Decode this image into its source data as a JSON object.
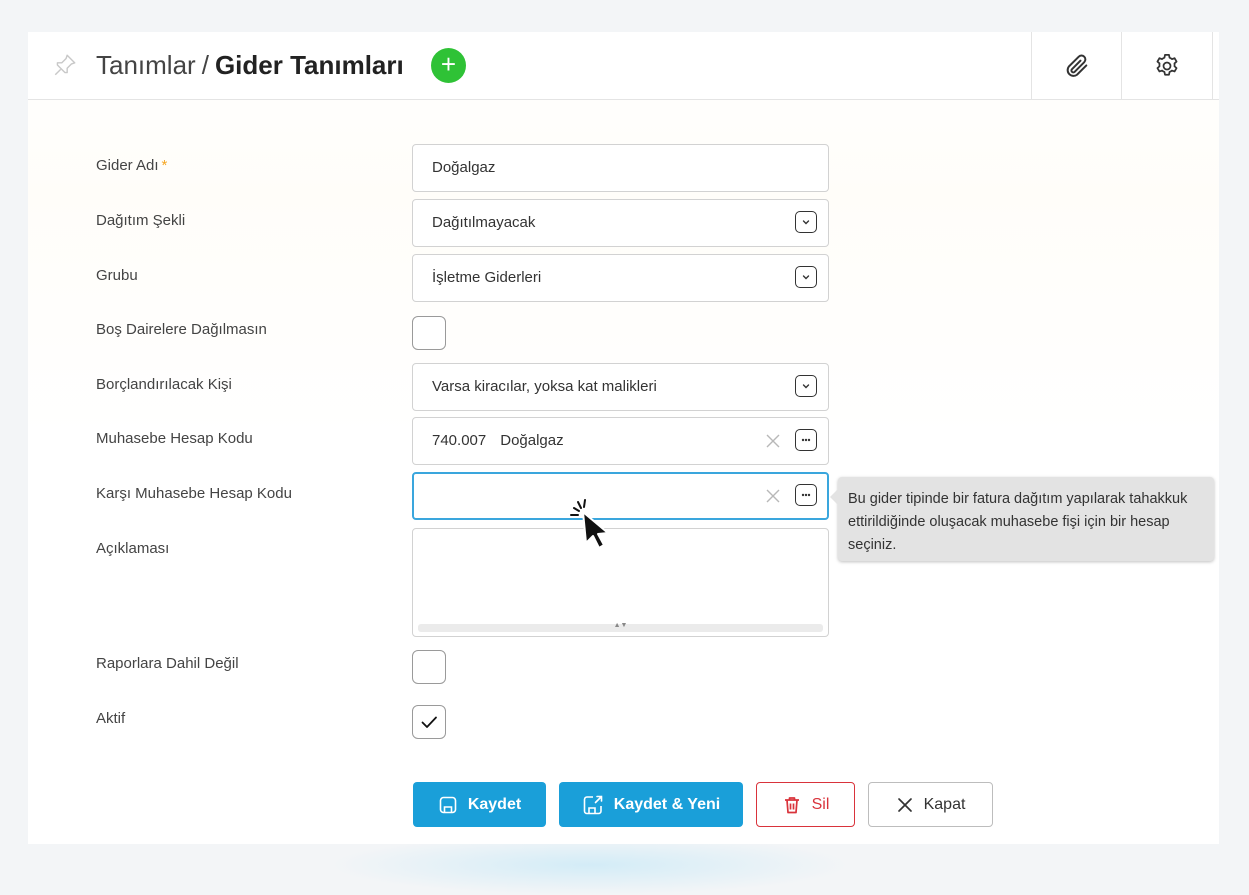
{
  "header": {
    "breadcrumb_parent": "Tanımlar",
    "breadcrumb_separator": "/",
    "breadcrumb_current": "Gider Tanımları",
    "add_label": "+",
    "icons": {
      "pin": "pin-icon",
      "add": "plus-icon",
      "attach": "paperclip-icon",
      "settings": "gear-icon"
    }
  },
  "form": {
    "gider_adi": {
      "label": "Gider Adı",
      "required_mark": "*",
      "value": "Doğalgaz"
    },
    "dagitim_sekli": {
      "label": "Dağıtım Şekli",
      "value": "Dağıtılmayacak"
    },
    "grubu": {
      "label": "Grubu",
      "value": "İşletme Giderleri"
    },
    "bos_daireler": {
      "label": "Boş Dairelere Dağılmasın",
      "checked": false
    },
    "borclandirilacak": {
      "label": "Borçlandırılacak Kişi",
      "value": "Varsa kiracılar, yoksa kat malikleri"
    },
    "muhasebe_kodu": {
      "label": "Muhasebe Hesap Kodu",
      "code": "740.007",
      "name": "Doğalgaz"
    },
    "karsi_muhasebe_kodu": {
      "label": "Karşı Muhasebe Hesap Kodu",
      "value": ""
    },
    "aciklama": {
      "label": "Açıklaması",
      "value": ""
    },
    "raporlara_dahil_degil": {
      "label": "Raporlara Dahil Değil",
      "checked": false
    },
    "aktif": {
      "label": "Aktif",
      "checked": true
    }
  },
  "tooltip": {
    "text": "Bu gider tipinde bir fatura dağıtım yapılarak tahakkuk ettirildiğinde oluşacak muhasebe fişi için bir hesap seçiniz."
  },
  "buttons": {
    "save": "Kaydet",
    "save_new": "Kaydet & Yeni",
    "delete": "Sil",
    "close": "Kapat"
  },
  "colors": {
    "primary": "#1a9fd9",
    "add_green": "#2fc236",
    "danger": "#d9333b",
    "required": "#f5a623",
    "focus_border": "#3aa6dd"
  }
}
